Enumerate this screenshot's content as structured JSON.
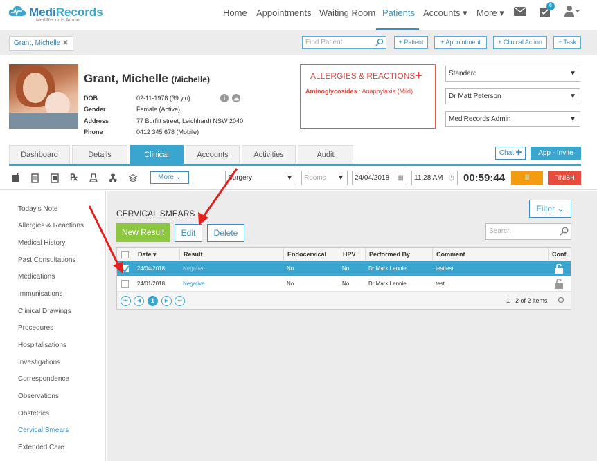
{
  "brand": {
    "name_part1": "Medi",
    "name_part2": "Records",
    "sub": "MediRecords Admin",
    "color": "#2e7fb0"
  },
  "nav": {
    "items": [
      {
        "label": "Home"
      },
      {
        "label": "Appointments"
      },
      {
        "label": "Waiting Room"
      },
      {
        "label": "Patients"
      },
      {
        "label": "Accounts ▾"
      },
      {
        "label": "More ▾"
      }
    ],
    "active": "Patients",
    "tasks_badge": "6"
  },
  "toolbar": {
    "patient_chip": "Grant, Michelle",
    "find_placeholder": "Find Patient",
    "quick_buttons": [
      "+ Patient",
      "+ Appointment",
      "+ Clinical Action",
      "+ Task"
    ]
  },
  "patient": {
    "name": "Grant, Michelle",
    "preferred": "(Michelle)",
    "fields": [
      {
        "label": "DOB",
        "value": "02-11-1978 (39 y.o)"
      },
      {
        "label": "Gender",
        "value": "Female (Active)"
      },
      {
        "label": "Address",
        "value": "77 Burfitt street, Leichhardt NSW 2040"
      },
      {
        "label": "Phone",
        "value": "0412 345 678 (Mobile)"
      }
    ]
  },
  "allergies": {
    "title": "ALLERGIES & REACTIONS",
    "add": "+",
    "item_drug": "Aminoglycosides",
    "item_reaction": " : Anaphylaxis (Mild)"
  },
  "selects": {
    "billing": "Standard",
    "doctor": "Dr Matt Peterson",
    "location": "MediRecords Admin"
  },
  "tabs": [
    "Dashboard",
    "Details",
    "Clinical",
    "Accounts",
    "Activities",
    "Audit"
  ],
  "active_tab": "Clinical",
  "chat_label": "Chat",
  "invite_label": "App - Invite",
  "clinical_toolbar": {
    "more_label": "More",
    "site": "Surgery",
    "rooms_placeholder": "Rooms",
    "date": "24/04/2018",
    "time": "11:28 AM",
    "timer": "00:59:44",
    "pause": "II",
    "finish": "FINISH"
  },
  "sidebar": {
    "items": [
      "Today's Note",
      "Allergies & Reactions",
      "Medical History",
      "Past Consultations",
      "Medications",
      "Immunisations",
      "Clinical Drawings",
      "Procedures",
      "Hospitalisations",
      "Investigations",
      "Correspondence",
      "Observations",
      "Obstetrics",
      "Cervical Smears",
      "Extended Care"
    ],
    "active": "Cervical Smears"
  },
  "main": {
    "title": "CERVICAL SMEARS",
    "filter": "Filter",
    "new_result": "New Result",
    "edit": "Edit",
    "delete": "Delete",
    "search_placeholder": "Search"
  },
  "table": {
    "columns": [
      "Date ▾",
      "Result",
      "Endocervical",
      "HPV",
      "Performed By",
      "Comment",
      "Conf."
    ],
    "rows": [
      {
        "date": "24/04/2018",
        "result": "Negative",
        "endo": "No",
        "hpv": "No",
        "by": "Dr Mark Lennie",
        "comment": "testtest",
        "selected": true
      },
      {
        "date": "24/01/2018",
        "result": "Negative",
        "endo": "No",
        "hpv": "No",
        "by": "Dr Mark Lennie",
        "comment": "test",
        "selected": false
      }
    ],
    "page": "1",
    "count": "1 - 2 of 2 items"
  },
  "colors": {
    "accent": "#3aa5cf",
    "new_result": "#8dc63f",
    "pause": "#f39c12",
    "finish": "#e74c3c",
    "allergy": "#e0463a",
    "arrow": "#e3201b"
  }
}
